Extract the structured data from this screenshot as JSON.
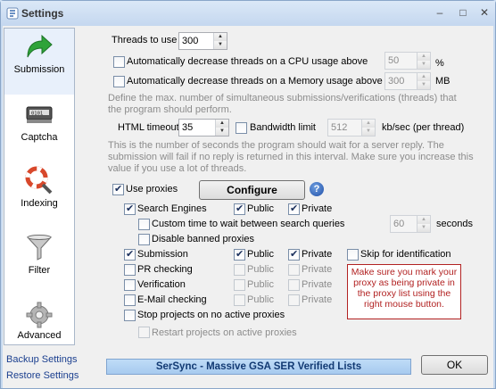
{
  "window": {
    "title": "Settings",
    "buttons": {
      "minimize": "–",
      "maximize": "□",
      "close": "✕"
    }
  },
  "sidebar": {
    "items": [
      {
        "label": "Submission",
        "icon": "green-arrow-icon"
      },
      {
        "label": "Captcha",
        "icon": "captcha-icon"
      },
      {
        "label": "Indexing",
        "icon": "lifebuoy-magnifier-icon"
      },
      {
        "label": "Filter",
        "icon": "funnel-icon"
      },
      {
        "label": "Advanced",
        "icon": "gear-icon"
      }
    ],
    "backup_link": "Backup Settings",
    "restore_link": "Restore Settings"
  },
  "threads": {
    "label": "Threads to use",
    "value": "300",
    "cpu_label": "Automatically decrease threads on a CPU usage above",
    "cpu_value": "50",
    "cpu_unit": "%",
    "mem_label": "Automatically decrease threads on a Memory usage above",
    "mem_value": "300",
    "mem_unit": "MB",
    "note": "Define the max. number of simultaneous submissions/verifications (threads) that the program should perform."
  },
  "timeout": {
    "label": "HTML timeout",
    "value": "35",
    "bandwidth_label": "Bandwidth limit",
    "bandwidth_value": "512",
    "bandwidth_unit": "kb/sec (per thread)",
    "note": "This is the number of seconds the program should wait for a server reply. The submission will fail if no reply is returned in this interval. Make sure you increase this value if you use a lot of threads."
  },
  "proxies": {
    "use_label": "Use proxies",
    "configure_label": "Configure",
    "help_glyph": "?",
    "search_engines_label": "Search Engines",
    "public_label": "Public",
    "private_label": "Private",
    "custom_wait_label": "Custom time to wait between search queries",
    "custom_wait_value": "60",
    "seconds_label": "seconds",
    "disable_banned_label": "Disable banned proxies",
    "submission_label": "Submission",
    "skip_identification_label": "Skip for identification",
    "pr_checking_label": "PR checking",
    "verification_label": "Verification",
    "email_checking_label": "E-Mail checking",
    "stop_projects_label": "Stop projects on no active proxies",
    "restart_projects_label": "Restart projects on active proxies",
    "warning": "Make sure you mark your proxy as being private in the proxy list using the right mouse button."
  },
  "footer": {
    "banner": "SerSync - Massive GSA SER Verified Lists",
    "ok_label": "OK"
  },
  "colors": {
    "title_bar": "#c4d7ef",
    "warning_border": "#b22222",
    "banner": "#a7caef",
    "link": "#1b3f8f"
  }
}
